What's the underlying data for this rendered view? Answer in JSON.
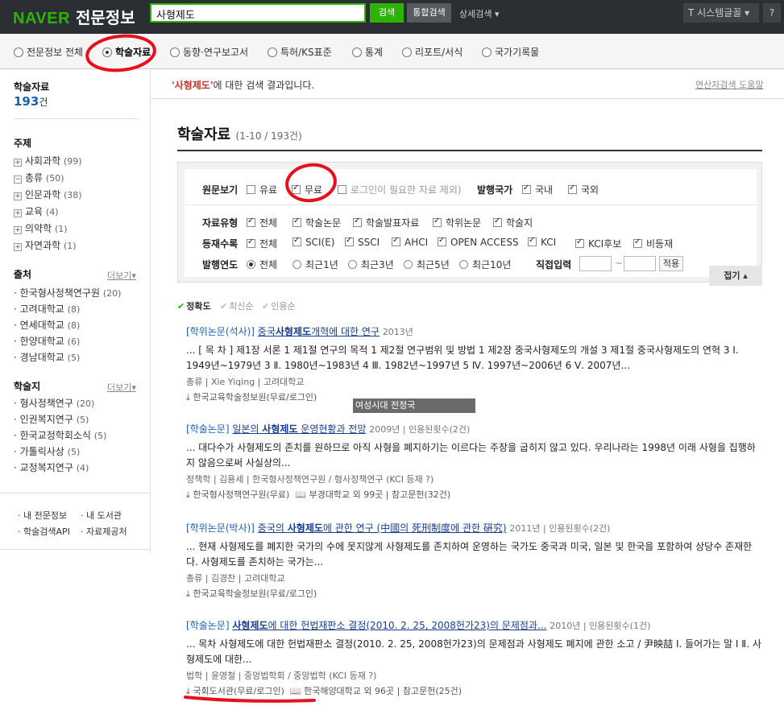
{
  "header": {
    "logo_brand": "NAVER",
    "logo_title": "전문정보",
    "search_value": "사형제도",
    "search_button": "검색",
    "unified_button": "통합검색",
    "advanced_search": "상세검색 ▾",
    "system_font": "T 시스템글꼴 ▾",
    "help": "?"
  },
  "tabs": [
    {
      "label": "전문정보 전체"
    },
    {
      "label": "학술자료"
    },
    {
      "label": "동향·연구보고서"
    },
    {
      "label": "특허/KS표준"
    },
    {
      "label": "통계"
    },
    {
      "label": "리포트/서식"
    },
    {
      "label": "국가기록물"
    }
  ],
  "sidebar": {
    "title": "학술자료",
    "count_num": "193",
    "count_unit": "건",
    "topic_title": "주제",
    "topics": [
      {
        "box": "+",
        "label": "사회과학",
        "count": "(99)"
      },
      {
        "box": "−",
        "label": "총류",
        "count": "(50)"
      },
      {
        "box": "+",
        "label": "인문과학",
        "count": "(38)"
      },
      {
        "box": "+",
        "label": "교육",
        "count": "(4)"
      },
      {
        "box": "+",
        "label": "의약학",
        "count": "(1)"
      },
      {
        "box": "+",
        "label": "자연과학",
        "count": "(1)"
      }
    ],
    "source_title": "출처",
    "source_more": "더보기▾",
    "sources": [
      {
        "label": "· 한국형사정책연구원",
        "count": "(20)"
      },
      {
        "label": "· 고려대학교",
        "count": "(8)"
      },
      {
        "label": "· 연세대학교",
        "count": "(8)"
      },
      {
        "label": "· 한양대학교",
        "count": "(6)"
      },
      {
        "label": "· 경남대학교",
        "count": "(5)"
      }
    ],
    "journal_title": "학술지",
    "journal_more": "더보기▾",
    "journals": [
      {
        "label": "· 형사정책연구",
        "count": "(20)"
      },
      {
        "label": "· 인권복지연구",
        "count": "(5)"
      },
      {
        "label": "· 한국교정학회소식",
        "count": "(5)"
      },
      {
        "label": "· 가톨릭사상",
        "count": "(5)"
      },
      {
        "label": "· 교정복지연구",
        "count": "(4)"
      }
    ],
    "footer": [
      "· 내 전문정보",
      "· 내 도서관",
      "· 학술검색API",
      "· 자료제공처"
    ]
  },
  "main": {
    "notice_query": "'사형제도'",
    "notice_rest": "에 대한 검색 결과입니다.",
    "help_link": "연산자검색 도움말",
    "heading": "학술자료",
    "heading_sub": "(1-10 / 193건)",
    "filters": {
      "view_label": "원문보기",
      "paid": "유료",
      "free": "무료",
      "login_excl": "로그인이 필요한 자료 제외)",
      "country_label": "발행국가",
      "domestic": "국내",
      "foreign": "국외",
      "type_label": "자료유형",
      "types": [
        "전체",
        "학술논문",
        "학술발표자료",
        "학위논문",
        "학술지"
      ],
      "index_label": "등재수록",
      "indexes": [
        "전체",
        "SCI(E)",
        "SSCI",
        "AHCI",
        "OPEN ACCESS",
        "KCI",
        "KCI후보",
        "비등재"
      ],
      "year_label": "발행연도",
      "years": [
        "전체",
        "최근1년",
        "최근3년",
        "최근5년",
        "최근10년"
      ],
      "direct_label": "직접입력",
      "dash": "~",
      "apply": "적용",
      "fold": "접기 ▴"
    },
    "sort": [
      "정확도",
      "최신순",
      "인용순"
    ],
    "tooltip": "여성시대 전정국"
  },
  "results": [
    {
      "type": "[학위논문(석사)]",
      "title_pre": "중국",
      "title_bold": "사형제도",
      "title_post": "개혁에 대한 연구",
      "meta": "2013년",
      "snippet": "... [ 목 차 ] 제1장 서론 1 제1절 연구의 목적 1 제2절 연구범위 및 방법 1 제2장 중국사형제도의 개설 3 제1절 중국사형제도의 연혁 3 Ⅰ. 1949년~1979년 3 Ⅱ. 1980년~1983년 4 Ⅲ. 1982년~1997년 5 Ⅳ. 1997년~2006년 6 Ⅴ. 2007년...",
      "info": "총류 | Xie Yiqing | 고려대학교",
      "download": "한국교육학술정보원(무료/로그인)"
    },
    {
      "type": "[학술논문]",
      "title_pre": "일본의 ",
      "title_bold": "사형제도",
      "title_post": " 운영현황과 전망",
      "meta": "2009년 | 인용된횟수(2건)",
      "snippet": "... 대다수가 사형제도의 존치를 원하므로 아직 사형을 폐지하기는 이르다는 주장을 굽히지 않고 있다. 우리나라는 1998년 이래 사형을 집행하지 않음으로써 사실상의...",
      "info": "정책학 | 김용세 | 한국형사정책연구원 / 형사정책연구 (KCI 등재 ?)",
      "download": "한국형사정책연구원(무료)",
      "library": "부경대학교 외 99곳 | 참고문헌(32건)"
    },
    {
      "type": "[학위논문(박사)]",
      "title_pre": "중국의 ",
      "title_bold": "사형제도",
      "title_post": "에 관한 연구 (中國의 死刑制度에 관한 硏究)",
      "meta": "2011년 | 인용된횟수(2건)",
      "snippet": "... 현재 사형제도를 폐지한 국가의 수에 못지않게 사형제도를 존치하여 운영하는 국가도 중국과 미국, 일본 및 한국을 포함하여 상당수 존재한다. 사형제도를 존치하는 국가는...",
      "info": "총류 | 김경찬 | 고려대학교",
      "download": "한국교육학술정보원(무료/로그인)"
    },
    {
      "type": "[학술논문]",
      "title_pre": "",
      "title_bold": "사형제도",
      "title_post": "에 대한 헌법재판소 결정(2010. 2. 25, 2008헌가23)의 문제점과...",
      "meta": "2010년 | 인용된횟수(1건)",
      "snippet": "... 목차 사형제도에 대한 헌법재판소 결정(2010. 2. 25, 2008헌가23)의 문제점과 사형제도 폐지에 관한 소고 / 尹映喆 Ⅰ. 들어가는 말 Ⅰ Ⅱ. 사형제도에 대한...",
      "info": "법학 | 윤영철 | 중앙법학회 / 중앙법학 (KCI 등재 ?)",
      "download": "국회도서관(무료/로그인)",
      "library": "한국해양대학교 외 96곳 | 참고문헌(25건)"
    }
  ]
}
